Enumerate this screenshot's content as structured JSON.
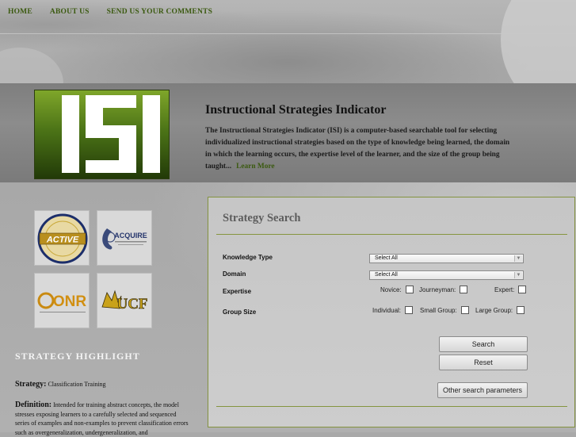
{
  "nav": {
    "items": [
      "HOME",
      "ABOUT US",
      "SEND US YOUR COMMENTS"
    ]
  },
  "header": {
    "title": "Instructional Strategies Indicator",
    "description": "The Instructional Strategies Indicator (ISI) is a computer-based searchable tool for selecting individualized instructional strategies based on the type of knowledge being learned, the domain in which the learning occurs, the expertise level of the learner, and the size of the group being taught...",
    "learn_more": "Learn More",
    "logo_text": "ISI"
  },
  "partners": [
    {
      "name": "ACTIVE",
      "icon": "active-logo"
    },
    {
      "name": "ACQUIRE",
      "icon": "acquire-logo"
    },
    {
      "name": "ONR",
      "icon": "onr-logo"
    },
    {
      "name": "UCF",
      "icon": "ucf-logo"
    }
  ],
  "highlight": {
    "title": "STRATEGY HIGHLIGHT",
    "strategy_label": "Strategy:",
    "strategy_value": "Classification Training",
    "definition_label": "Definition:",
    "definition_text": "Intended for training abstract concepts, the model stresses exposing learners to a carefully selected and sequenced series of examples and non-examples to prevent classification errors such as overgeneralization, undergeneralization, and"
  },
  "search": {
    "title": "Strategy Search",
    "knowledge_type": {
      "label": "Knowledge Type",
      "value": "Select All"
    },
    "domain": {
      "label": "Domain",
      "value": "Select All"
    },
    "expertise": {
      "label": "Expertise",
      "options": [
        "Novice:",
        "Journeyman:",
        "Expert:"
      ]
    },
    "group_size": {
      "label": "Group Size",
      "options": [
        "Individual:",
        "Small Group:",
        "Large Group:"
      ]
    },
    "buttons": {
      "search": "Search",
      "reset": "Reset",
      "other": "Other search parameters"
    }
  },
  "colors": {
    "accent": "#3b5a10",
    "rule": "#85953f",
    "logo_green": "#4c7417"
  }
}
